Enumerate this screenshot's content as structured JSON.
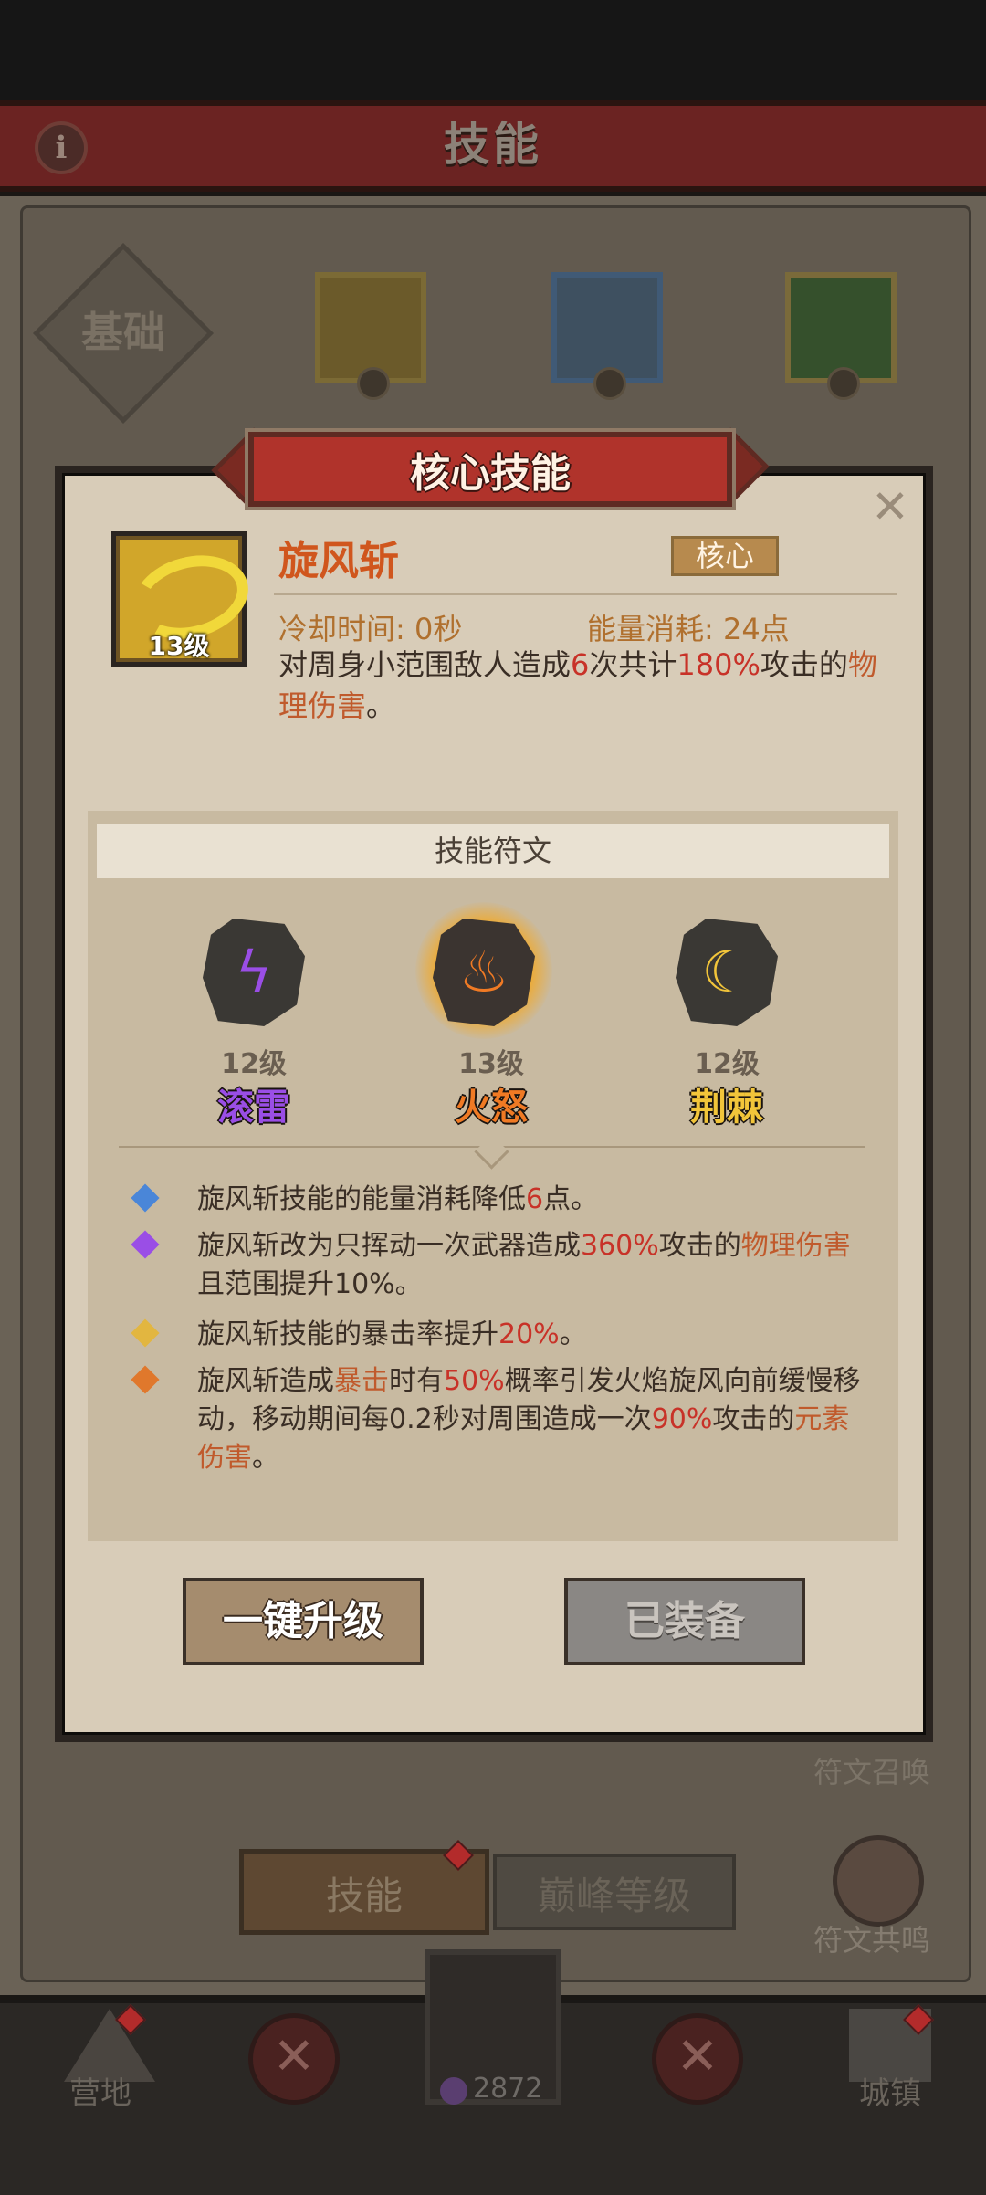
{
  "header": {
    "title": "技能",
    "info_glyph": "i"
  },
  "skill_tabs": {
    "basic_label": "基础"
  },
  "modal": {
    "ribbon_title": "核心技能",
    "close_glyph": "✕",
    "skill": {
      "icon": "whirlwind-icon",
      "level_label": "13级",
      "name": "旋风斩",
      "type_badge": "核心",
      "cooldown": "冷却时间: 0秒",
      "energy_cost": "能量消耗: 24点",
      "description": {
        "p1": "对周身小范围敌人造成",
        "hits": "6",
        "p2": "次共计",
        "percent": "180%",
        "p3": "攻击的",
        "damage_type": "物理伤害",
        "p4": "。"
      }
    },
    "runes_section": {
      "title": "技能符文",
      "runes": [
        {
          "icon": "lightning-rune-icon",
          "glyph": "ϟ",
          "level": "12级",
          "name": "滚雷",
          "color": "#9a4ee6"
        },
        {
          "icon": "fire-rune-icon",
          "glyph": "♨",
          "level": "13级",
          "name": "火怒",
          "color": "#f07a24"
        },
        {
          "icon": "thorn-rune-icon",
          "glyph": "☾",
          "level": "12级",
          "name": "荆棘",
          "color": "#f2c53a"
        }
      ],
      "effects": [
        {
          "color": "#4a86d8",
          "p1": "旋风斩技能的能量消耗降低",
          "v1": "6",
          "p2": "点。"
        },
        {
          "color": "#9a4ee6",
          "p1": "旋风斩改为只挥动一次武器造成",
          "v1": "360%",
          "p2": "攻击的",
          "v2": "物理伤害",
          "p3": "且范围提升10%。"
        },
        {
          "color": "#e2b640",
          "p1": "旋风斩技能的暴击率提升",
          "v1": "20%",
          "p2": "。"
        },
        {
          "color": "#e0782c",
          "p1": "旋风斩造成",
          "v1": "暴击",
          "p2": "时有",
          "v2": "50%",
          "p3": "概率引发火焰旋风向前缓慢移动，移动期间每0.2秒对周围造成一次",
          "v3": "90%",
          "p4": "攻击的",
          "v4": "元素伤害",
          "p5": "。"
        }
      ]
    },
    "buttons": {
      "upgrade": "一键升级",
      "equipped": "已装备"
    }
  },
  "background": {
    "rune_summon_label": "符文召唤",
    "rune_resonance_label": "符文共鸣",
    "bottom_tabs": {
      "skill": "技能",
      "peak_level": "巅峰等级"
    }
  },
  "navbar": {
    "camp_label": "营地",
    "town_label": "城镇",
    "energy_value": "2872",
    "lock_glyph": "✕"
  },
  "colors": {
    "accent_red": "#c83228",
    "accent_orange": "#c05a2c",
    "ribbon": "#b0332b"
  }
}
